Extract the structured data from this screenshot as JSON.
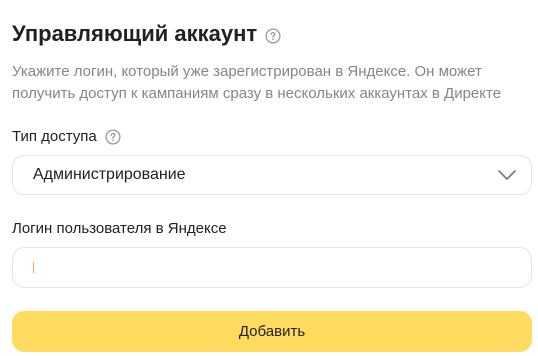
{
  "title": "Управляющий аккаунт",
  "description": "Укажите логин, который уже зарегистрирован в Яндексе. Он может получить доступ к кампаниям сразу в нескольких аккаунтах в Директе",
  "access_type": {
    "label": "Тип доступа",
    "selected": "Администрирование"
  },
  "login": {
    "label": "Логин пользователя в Яндексе",
    "value": ""
  },
  "submit": {
    "label": "Добавить"
  },
  "icons": {
    "help": "question-circle-icon",
    "dropdown": "chevron-down-icon"
  },
  "colors": {
    "button_background": "#ffdc60",
    "caret": "#f4a261",
    "description_text": "#868686"
  }
}
